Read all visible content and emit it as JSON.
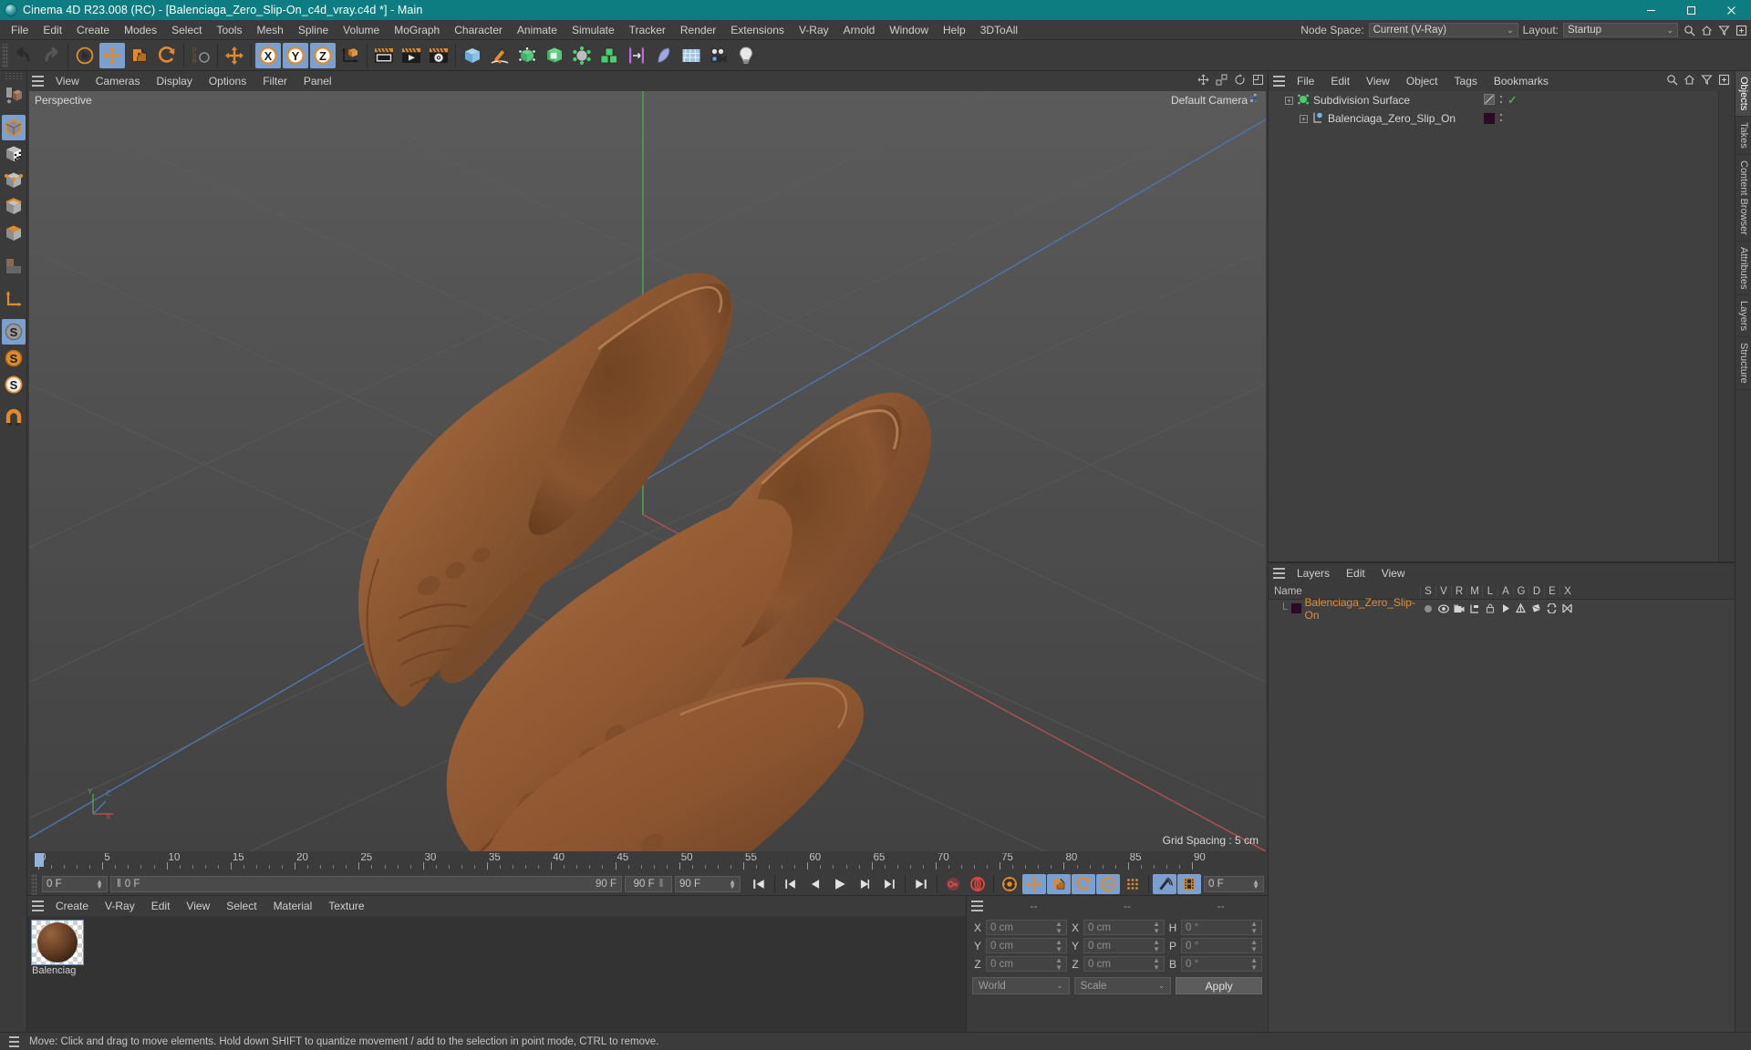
{
  "window": {
    "title": "Cinema 4D R23.008 (RC) - [Balenciaga_Zero_Slip-On_c4d_vray.c4d *] - Main",
    "minimize": "—",
    "maximize": "▢",
    "close": "✕",
    "accent": "#0d7d82"
  },
  "menubar": {
    "items": [
      "File",
      "Edit",
      "Create",
      "Modes",
      "Select",
      "Tools",
      "Mesh",
      "Spline",
      "Volume",
      "MoGraph",
      "Character",
      "Animate",
      "Simulate",
      "Tracker",
      "Render",
      "Extensions",
      "V-Ray",
      "Arnold",
      "Window",
      "Help",
      "3DToAll"
    ],
    "node_space_label": "Node Space:",
    "node_space_value": "Current (V-Ray)",
    "layout_label": "Layout:",
    "layout_value": "Startup",
    "chevron": "⌄"
  },
  "toolbar": {
    "groups": [
      {
        "name": "history",
        "buttons": [
          {
            "name": "undo-button",
            "icon": "undo",
            "on": false
          },
          {
            "name": "redo-button",
            "icon": "redo",
            "on": false
          }
        ]
      },
      {
        "name": "transform",
        "buttons": [
          {
            "name": "live-selection-button",
            "icon": "live-selection",
            "on": false
          },
          {
            "name": "move-tool-button",
            "icon": "move",
            "on": true
          },
          {
            "name": "scale-tool-button",
            "icon": "scale",
            "on": false
          },
          {
            "name": "rotate-tool-button",
            "icon": "rotate",
            "on": false
          }
        ]
      },
      {
        "name": "psr",
        "buttons": [
          {
            "name": "psr-reset-button",
            "icon": "psr",
            "on": false
          }
        ]
      },
      {
        "name": "world",
        "buttons": [
          {
            "name": "world-object-axis-button",
            "icon": "move",
            "on": false
          }
        ]
      },
      {
        "name": "axis-lock",
        "buttons": [
          {
            "name": "lock-x-axis-button",
            "icon": "x-axis",
            "on": true
          },
          {
            "name": "lock-y-axis-button",
            "icon": "y-axis",
            "on": true
          },
          {
            "name": "lock-z-axis-button",
            "icon": "z-axis",
            "on": true
          },
          {
            "name": "world-coordinate-button",
            "icon": "world-axis",
            "on": false
          }
        ]
      },
      {
        "name": "render",
        "buttons": [
          {
            "name": "render-view-button",
            "icon": "render-view",
            "on": false
          },
          {
            "name": "render-to-picture-viewer-button",
            "icon": "render-picture",
            "on": false
          },
          {
            "name": "render-settings-button",
            "icon": "render-settings",
            "on": false
          }
        ]
      },
      {
        "name": "create",
        "buttons": [
          {
            "name": "add-cube-button",
            "icon": "cube-blue",
            "on": false
          },
          {
            "name": "add-spline-button",
            "icon": "pen",
            "on": false
          },
          {
            "name": "add-nurbs-button",
            "icon": "nurbs-green",
            "on": false
          },
          {
            "name": "add-modeling-object-button",
            "icon": "boole-green",
            "on": false
          },
          {
            "name": "add-deformer-button",
            "icon": "deformer-grey",
            "on": false
          },
          {
            "name": "add-mograph-button",
            "icon": "cubes-green",
            "on": false
          },
          {
            "name": "add-field-button",
            "icon": "field-magenta",
            "on": false
          },
          {
            "name": "add-character-button",
            "icon": "character-blue",
            "on": false
          },
          {
            "name": "add-scene-object-button",
            "icon": "scene-grid",
            "on": false
          },
          {
            "name": "add-camera-button",
            "icon": "camera",
            "on": false
          },
          {
            "name": "add-light-button",
            "icon": "light-bulb",
            "on": false
          }
        ]
      }
    ]
  },
  "leftbar": {
    "buttons": [
      {
        "name": "make-editable-button",
        "icon": "make-editable",
        "on": false
      },
      {
        "name": "model-mode-button",
        "icon": "model-cube",
        "on": true
      },
      {
        "name": "texture-mode-button",
        "icon": "texture-cube",
        "on": false
      },
      {
        "name": "points-mode-button",
        "icon": "points-cube",
        "on": false
      },
      {
        "name": "edges-mode-button",
        "icon": "edges-cube",
        "on": false
      },
      {
        "name": "polygons-mode-button",
        "icon": "polygons-cube",
        "on": false
      },
      {
        "name": "uv-mode-button",
        "icon": "uv-square",
        "on": false
      },
      {
        "name": "axis-mode-button",
        "icon": "axis-arrow",
        "on": false
      },
      {
        "name": "enable-snap-button",
        "icon": "snap-s-grey",
        "on": true
      },
      {
        "name": "snap-settings-button",
        "icon": "snap-s-orange",
        "on": false
      },
      {
        "name": "quantize-button",
        "icon": "snap-s-white",
        "on": false
      },
      {
        "name": "workplane-button",
        "icon": "magnet",
        "on": false
      }
    ]
  },
  "viewport": {
    "menu": [
      "View",
      "Cameras",
      "Display",
      "Options",
      "Filter",
      "Panel"
    ],
    "label": "Perspective",
    "camera": "Default Camera",
    "grid_spacing": "Grid Spacing : 5 cm",
    "axis_labels": {
      "x": "X",
      "y": "Y",
      "z": "Z"
    },
    "icons": [
      "move-view-icon",
      "scale-view-icon",
      "rotate-view-icon",
      "maximize-view-icon"
    ]
  },
  "timeline": {
    "ticks": [
      0,
      5,
      10,
      15,
      20,
      25,
      30,
      35,
      40,
      45,
      50,
      55,
      60,
      65,
      70,
      75,
      80,
      85,
      90
    ],
    "start": 0,
    "end": 90,
    "current_frame": "0 F",
    "preview_min": "0 F",
    "preview_max": "90 F",
    "range_end_left": "90 F",
    "range_end_right": "90 F",
    "end_frame_right": "0 F",
    "transport": [
      {
        "name": "go-to-start-button",
        "icon": "skip-start"
      },
      {
        "name": "previous-keyframe-button",
        "icon": "prev-key"
      },
      {
        "name": "previous-frame-button",
        "icon": "prev-frame"
      },
      {
        "name": "play-button",
        "icon": "play"
      },
      {
        "name": "next-frame-button",
        "icon": "next-frame"
      },
      {
        "name": "next-keyframe-button",
        "icon": "next-key"
      },
      {
        "name": "go-to-end-button",
        "icon": "skip-end"
      },
      {
        "name": "record-active-objects-button",
        "icon": "key-record"
      },
      {
        "name": "autokeying-button",
        "icon": "autokey"
      },
      {
        "name": "keyframe-selection-button",
        "icon": "keyframe-sel"
      },
      {
        "name": "position-key-button",
        "icon": "move",
        "on": true
      },
      {
        "name": "scale-key-button",
        "icon": "scale",
        "on": true
      },
      {
        "name": "rotation-key-button",
        "icon": "rotate",
        "on": true
      },
      {
        "name": "parameter-key-button",
        "icon": "param-p",
        "on": true
      },
      {
        "name": "point-level-animation-button",
        "icon": "pla-dots"
      },
      {
        "name": "motion-record-button",
        "icon": "motion-record",
        "on": true
      },
      {
        "name": "timeline-button",
        "icon": "film-strip",
        "on": true
      }
    ]
  },
  "material_manager": {
    "menu": [
      "Create",
      "V-Ray",
      "Edit",
      "View",
      "Select",
      "Material",
      "Texture"
    ],
    "materials": [
      {
        "name": "Balenciaga_Zero_Slip-On",
        "display": "Balenciag",
        "color": "#6b4226"
      }
    ]
  },
  "coordinate_manager": {
    "headers": [
      "--",
      "--",
      "--"
    ],
    "position": [
      {
        "label": "X",
        "value": "0 cm"
      },
      {
        "label": "Y",
        "value": "0 cm"
      },
      {
        "label": "Z",
        "value": "0 cm"
      }
    ],
    "size": [
      {
        "label": "X",
        "value": "0 cm"
      },
      {
        "label": "Y",
        "value": "0 cm"
      },
      {
        "label": "Z",
        "value": "0 cm"
      }
    ],
    "rotation": [
      {
        "label": "H",
        "value": "0 °"
      },
      {
        "label": "P",
        "value": "0 °"
      },
      {
        "label": "B",
        "value": "0 °"
      }
    ],
    "system": "World",
    "mode": "Scale",
    "apply": "Apply"
  },
  "object_manager": {
    "menu": [
      "File",
      "Edit",
      "View",
      "Object",
      "Tags",
      "Bookmarks"
    ],
    "icons": [
      "search-icon",
      "home-icon",
      "filter-icon",
      "add-icon"
    ],
    "objects": [
      {
        "name": "Subdivision Surface",
        "type": "generator",
        "depth": 0,
        "tag_check": "✓"
      },
      {
        "name": "Balenciaga_Zero_Slip_On",
        "type": "polygon",
        "depth": 1,
        "tag_swatch": "#2b0a26"
      }
    ]
  },
  "layer_manager": {
    "menu": [
      "Layers",
      "Edit",
      "View"
    ],
    "columns": [
      "Name",
      "S",
      "V",
      "R",
      "M",
      "L",
      "A",
      "G",
      "D",
      "E",
      "X"
    ],
    "rows": [
      {
        "name": "Balenciaga_Zero_Slip-On",
        "color": "#2b0a26",
        "flags": [
          "solo-dot",
          "visible-eye",
          "render-cam",
          "manager-tree",
          "lock-closed",
          "animate-play",
          "generator",
          "deformer",
          "expression",
          "xref"
        ]
      }
    ]
  },
  "side_tabs": [
    {
      "label": "Objects",
      "active": true
    },
    {
      "label": "Takes",
      "active": false
    },
    {
      "label": "Content Browser",
      "active": false
    },
    {
      "label": "Attributes",
      "active": false
    },
    {
      "label": "Layers",
      "active": false
    },
    {
      "label": "Structure",
      "active": false
    }
  ],
  "statusbar": {
    "message": "Move: Click and drag to move elements. Hold down SHIFT to quantize movement / add to the selection in point mode, CTRL to remove."
  }
}
